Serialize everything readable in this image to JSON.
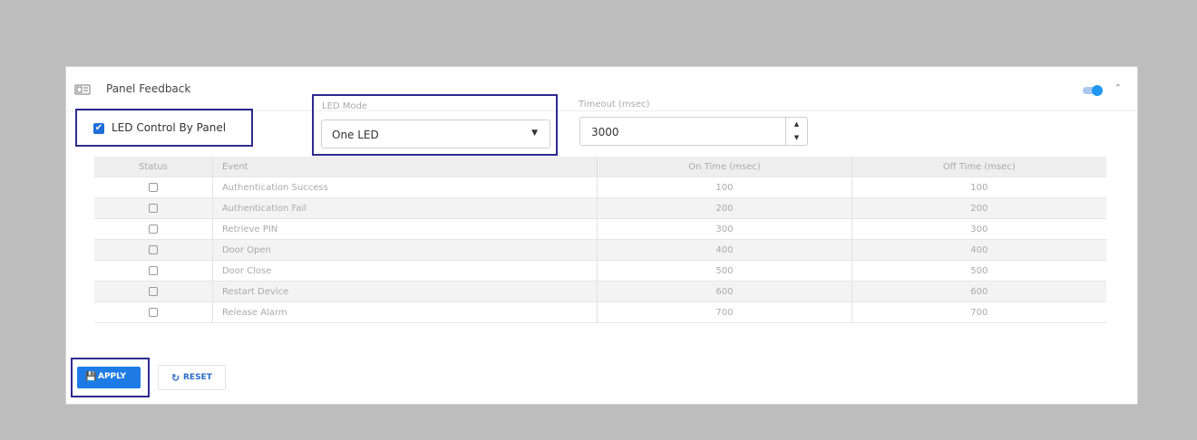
{
  "card": {
    "title": "Panel Feedback",
    "toggle_on": true
  },
  "led_control": {
    "label": "LED Control By Panel",
    "checked": true,
    "check_glyph": "✔"
  },
  "led_mode": {
    "label": "LED Mode",
    "value": "One LED",
    "caret": "▼"
  },
  "timeout": {
    "label": "Timeout (msec)",
    "value": "3000",
    "up_glyph": "▲",
    "down_glyph": "▼"
  },
  "table": {
    "headers": [
      "Status",
      "Event",
      "On Time (msec)",
      "Off Time (msec)"
    ],
    "rows": [
      {
        "event": "Authentication Success",
        "on": "100",
        "off": "100"
      },
      {
        "event": "Authentication Fail",
        "on": "200",
        "off": "200"
      },
      {
        "event": "Retrieve PIN",
        "on": "300",
        "off": "300"
      },
      {
        "event": "Door Open",
        "on": "400",
        "off": "400"
      },
      {
        "event": "Door Close",
        "on": "500",
        "off": "500"
      },
      {
        "event": "Restart Device",
        "on": "600",
        "off": "600"
      },
      {
        "event": "Release Alarm",
        "on": "700",
        "off": "700"
      }
    ]
  },
  "buttons": {
    "apply": "APPLY",
    "apply_icon": "💾",
    "reset": "RESET",
    "reset_icon": "↻"
  },
  "colors": {
    "accent": "#1e7be6",
    "focus_border": "#2e2a8f",
    "background": "#bdbdbd"
  }
}
